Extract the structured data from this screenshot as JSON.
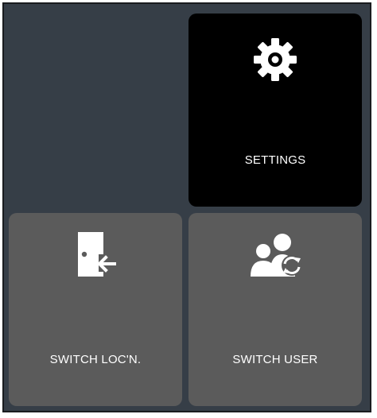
{
  "tiles": {
    "settings": {
      "label": "SETTINGS",
      "icon": "gear-icon"
    },
    "switch_location": {
      "label": "SWITCH LOC'N.",
      "icon": "door-exit-icon"
    },
    "switch_user": {
      "label": "SWITCH USER",
      "icon": "users-switch-icon"
    }
  },
  "colors": {
    "background": "#363e47",
    "settings_tile": "#000000",
    "tile": "#5b5b5b",
    "text": "#ffffff"
  }
}
